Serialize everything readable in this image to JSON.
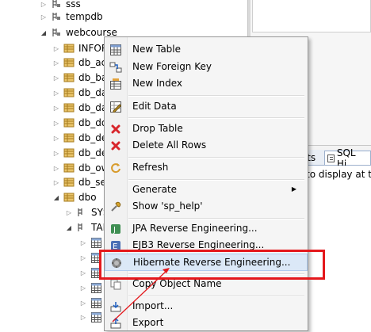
{
  "tree": {
    "items": [
      {
        "label": "sss",
        "icon": "database-icon",
        "expanded": false
      },
      {
        "label": "tempdb",
        "icon": "database-icon",
        "expanded": false
      },
      {
        "label": "webcourse",
        "icon": "database-icon",
        "expanded": true
      },
      {
        "label": "INFOR",
        "icon": "schema-icon",
        "expanded": false
      },
      {
        "label": "db_ac",
        "icon": "schema-icon",
        "expanded": false
      },
      {
        "label": "db_ba",
        "icon": "schema-icon",
        "expanded": false
      },
      {
        "label": "db_da",
        "icon": "schema-icon",
        "expanded": false
      },
      {
        "label": "db_da",
        "icon": "schema-icon",
        "expanded": false
      },
      {
        "label": "db_dd",
        "icon": "schema-icon",
        "expanded": false
      },
      {
        "label": "db_de",
        "icon": "schema-icon",
        "expanded": false
      },
      {
        "label": "db_de",
        "icon": "schema-icon",
        "expanded": false
      },
      {
        "label": "db_ow",
        "icon": "schema-icon",
        "expanded": false
      },
      {
        "label": "db_se",
        "icon": "schema-icon",
        "expanded": false
      },
      {
        "label": "dbo",
        "icon": "schema-icon",
        "expanded": true
      },
      {
        "label": "SYS",
        "icon": "folder-icon",
        "expanded": false
      },
      {
        "label": "TAI",
        "icon": "folder-icon",
        "expanded": true
      },
      {
        "label": "",
        "icon": "table-icon",
        "expanded": false
      },
      {
        "label": "",
        "icon": "table-icon",
        "expanded": false
      },
      {
        "label": "",
        "icon": "table-icon",
        "expanded": false
      },
      {
        "label": "",
        "icon": "table-icon",
        "expanded": false
      },
      {
        "label": "",
        "icon": "table-icon",
        "expanded": false
      },
      {
        "label": "",
        "icon": "table-icon",
        "expanded": false
      }
    ]
  },
  "menu": {
    "items": [
      {
        "label": "New Table",
        "icon": "new-table-icon"
      },
      {
        "label": "New Foreign Key",
        "icon": "foreign-key-icon"
      },
      {
        "label": "New Index",
        "icon": "new-index-icon"
      },
      {
        "label": "Edit Data",
        "icon": "edit-data-icon"
      },
      {
        "label": "Drop Table",
        "icon": "drop-table-icon"
      },
      {
        "label": "Delete All Rows",
        "icon": "delete-rows-icon"
      },
      {
        "label": "Refresh",
        "icon": "refresh-icon"
      },
      {
        "label": "Generate",
        "icon": "",
        "submenu": true
      },
      {
        "label": "Show 'sp_help'",
        "icon": "sp-help-icon"
      },
      {
        "label": "JPA Reverse Engineering...",
        "icon": "jpa-icon"
      },
      {
        "label": "EJB3 Reverse Engineering...",
        "icon": "ejb3-icon"
      },
      {
        "label": "Hibernate Reverse Engineering...",
        "icon": "hibernate-icon",
        "hover": true
      },
      {
        "label": "Copy Object Name",
        "icon": "copy-icon"
      },
      {
        "label": "Import...",
        "icon": "import-icon"
      },
      {
        "label": "Export",
        "icon": "export-icon"
      }
    ]
  },
  "right_panel": {
    "tab_results": "sults",
    "tab_sql": "SQL Hi",
    "no_results_text": "s to display at t"
  },
  "colors": {
    "highlight": "#e4181c",
    "menu_hover": "#dbe8f7"
  }
}
